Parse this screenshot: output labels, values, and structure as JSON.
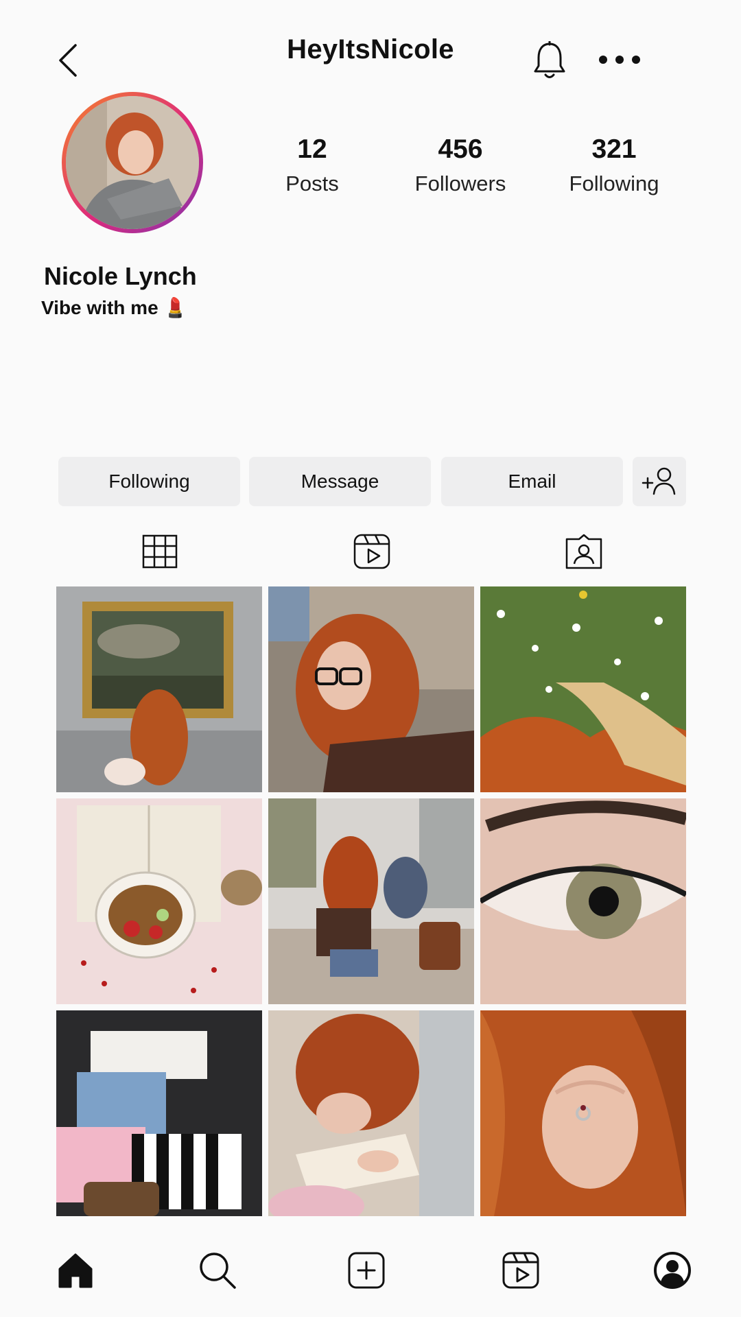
{
  "header": {
    "username": "HeyItsNicole"
  },
  "profile": {
    "full_name": "Nicole Lynch",
    "bio": "Vibe with me 💄"
  },
  "stats": [
    {
      "value": "12",
      "label": "Posts"
    },
    {
      "value": "456",
      "label": "Followers"
    },
    {
      "value": "321",
      "label": "Following"
    }
  ],
  "actions": {
    "following_label": "Following",
    "message_label": "Message",
    "email_label": "Email"
  },
  "tabs": [
    "grid-icon",
    "reels-icon",
    "tagged-icon"
  ],
  "nav": [
    "home-icon",
    "search-icon",
    "create-icon",
    "reels-icon",
    "profile-icon"
  ],
  "posts": [
    {
      "subject": "woman-viewing-painting"
    },
    {
      "subject": "woman-with-glasses"
    },
    {
      "subject": "daisies-and-hair"
    },
    {
      "subject": "book-and-fruit-bowl"
    },
    {
      "subject": "woman-in-cafe"
    },
    {
      "subject": "close-up-eye"
    },
    {
      "subject": "shopping-bags"
    },
    {
      "subject": "woman-writing"
    },
    {
      "subject": "hand-with-ring"
    }
  ],
  "colors": {
    "background": "#fafafa",
    "button_bg": "#eeeeef",
    "ring_gradient": [
      "#f58529",
      "#dd2a7b",
      "#8134af"
    ]
  }
}
